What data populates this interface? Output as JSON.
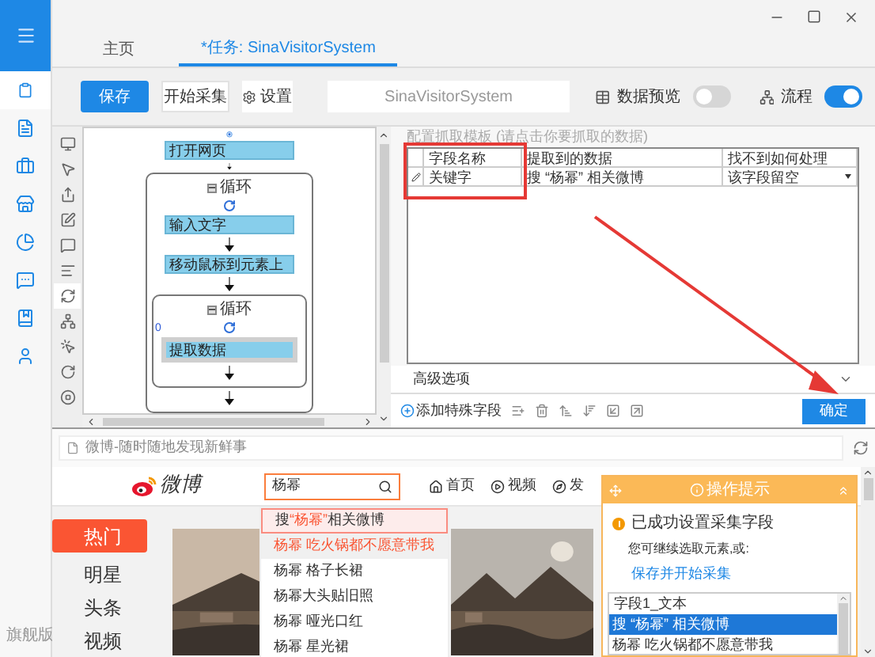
{
  "sidebar": {
    "items": [
      {
        "selected": true
      },
      {
        "selected": false
      },
      {
        "selected": false
      },
      {
        "selected": false
      },
      {
        "selected": false
      },
      {
        "selected": false
      },
      {
        "selected": false
      },
      {
        "selected": false
      }
    ],
    "edition": "旗舰版"
  },
  "tabs": [
    {
      "label": "主页",
      "selected": false
    },
    {
      "label": "*任务: SinaVisitorSystem",
      "selected": true
    }
  ],
  "toolbar": {
    "save": "保存",
    "start": "开始采集",
    "settings": "设置",
    "task_name": "SinaVisitorSystem",
    "preview": {
      "label": "数据预览",
      "on": false
    },
    "flow": {
      "label": "流程",
      "on": true
    }
  },
  "tools": [
    {
      "selected": false
    },
    {
      "selected": false
    },
    {
      "selected": false
    },
    {
      "selected": false
    },
    {
      "selected": false
    },
    {
      "selected": false
    },
    {
      "selected": true
    },
    {
      "selected": false
    },
    {
      "selected": false
    },
    {
      "selected": false
    },
    {
      "selected": false
    }
  ],
  "flow": [
    {
      "kind": "step",
      "label": "打开网页",
      "selected": false
    },
    {
      "kind": "loop",
      "label": "循环",
      "children": [
        {
          "kind": "step",
          "label": "输入文字",
          "selected": false
        },
        {
          "kind": "step",
          "label": "移动鼠标到元素上",
          "selected": false
        },
        {
          "kind": "loop",
          "label": "循环",
          "children": [
            {
              "kind": "step",
              "label": "提取数据",
              "selected": true,
              "badge": "0"
            }
          ]
        }
      ]
    }
  ],
  "template": {
    "caption": "配置抓取模板 (请点击你要抓取的数据)",
    "columns": [
      "字段名称",
      "提取到的数据",
      "找不到如何处理"
    ],
    "rows": [
      {
        "cells": [
          "关键字",
          "搜 “杨幂” 相关微博",
          "该字段留空"
        ]
      }
    ],
    "advanced": "高级选项",
    "add_field": "添加特殊字段",
    "confirm": "确定"
  },
  "browser": {
    "address": "微博-随时随地发现新鲜事"
  },
  "weibo": {
    "logo": "微博",
    "search": "杨幂",
    "nav": [
      "首页",
      "视频",
      "发"
    ],
    "suggestions": [
      {
        "kind": "search",
        "parts": [
          "搜 ",
          "“杨幂”",
          " 相关微博"
        ]
      },
      {
        "kind": "hot",
        "text": "杨幂 吃火锅都不愿意带我"
      },
      {
        "kind": "plain",
        "text": "杨幂 格子长裙"
      },
      {
        "kind": "plain",
        "text": "杨幂大头贴旧照"
      },
      {
        "kind": "plain",
        "text": "杨幂 哑光口红"
      },
      {
        "kind": "plain",
        "text": "杨幂 星光裙"
      }
    ],
    "categories": [
      {
        "label": "热门",
        "selected": true
      },
      {
        "label": "明星",
        "selected": false
      },
      {
        "label": "头条",
        "selected": false
      },
      {
        "label": "视频",
        "selected": false
      }
    ]
  },
  "tips": {
    "title": "操作提示",
    "message": "已成功设置采集字段",
    "hint": "您可继续选取元素,或:",
    "link": "保存并开始采集",
    "list_header": "字段1_文本",
    "list": [
      {
        "text": "搜 “杨幂” 相关微博",
        "selected": true
      },
      {
        "text": "杨幂 吃火锅都不愿意带我",
        "selected": false
      }
    ]
  }
}
